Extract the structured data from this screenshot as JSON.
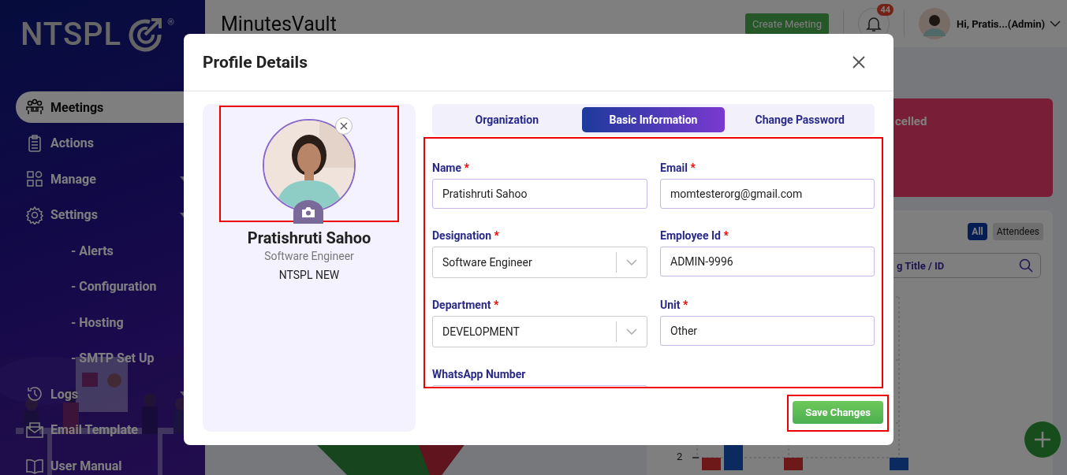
{
  "app": {
    "logo": "NTSPL",
    "logo_mark": "®",
    "title": "MinutesVault",
    "create_button": "Create Meeting",
    "notification_count": "44",
    "user_greeting": "Hi, Pratis...(Admin)"
  },
  "sidebar": {
    "items": [
      {
        "label": "Meetings",
        "selected": true,
        "expandable": false
      },
      {
        "label": "Actions",
        "selected": false,
        "expandable": false
      },
      {
        "label": "Manage",
        "selected": false,
        "expandable": true
      },
      {
        "label": "Settings",
        "selected": false,
        "expandable": true,
        "children": [
          {
            "label": "- Alerts",
            "selected": false
          },
          {
            "label": "- Configuration",
            "selected": false
          },
          {
            "label": "- Hosting",
            "selected": false
          },
          {
            "label": "- SMTP Set Up",
            "selected": false
          }
        ]
      },
      {
        "label": "Logs",
        "selected": false,
        "expandable": true
      },
      {
        "label": "Email Template",
        "selected": false,
        "expandable": false
      },
      {
        "label": "User Manual",
        "selected": false,
        "expandable": false
      }
    ]
  },
  "dashboard": {
    "status_card": "celled",
    "filters": [
      {
        "label": "All",
        "selected": true
      },
      {
        "label": "Attendees",
        "selected": false
      }
    ],
    "search": {
      "placeholder": "g Title / ID"
    },
    "chart_tick": "2"
  },
  "modal": {
    "title": "Profile Details",
    "profile": {
      "name": "Pratishruti Sahoo",
      "designation": "Software Engineer",
      "organization": "NTSPL NEW"
    },
    "tabs": [
      {
        "label": "Organization",
        "selected": false
      },
      {
        "label": "Basic Information",
        "selected": true
      },
      {
        "label": "Change Password",
        "selected": false
      }
    ],
    "fields": [
      {
        "label": "Name",
        "required_mark": "*",
        "kind": "text",
        "value": "Pratishruti Sahoo"
      },
      {
        "label": "Email",
        "required_mark": "*",
        "kind": "text",
        "value": "momtesterorg@gmail.com"
      },
      {
        "label": "Designation",
        "required_mark": "*",
        "kind": "select",
        "value": "Software Engineer"
      },
      {
        "label": "Employee Id",
        "required_mark": "*",
        "kind": "text",
        "value": "ADMIN-9996"
      },
      {
        "label": "Department",
        "required_mark": "*",
        "kind": "select",
        "value": "DEVELOPMENT"
      },
      {
        "label": "Unit",
        "required_mark": "*",
        "kind": "text",
        "value": "Other"
      },
      {
        "label": "WhatsApp Number",
        "kind": "text"
      }
    ],
    "save_button": "Save Changes"
  }
}
